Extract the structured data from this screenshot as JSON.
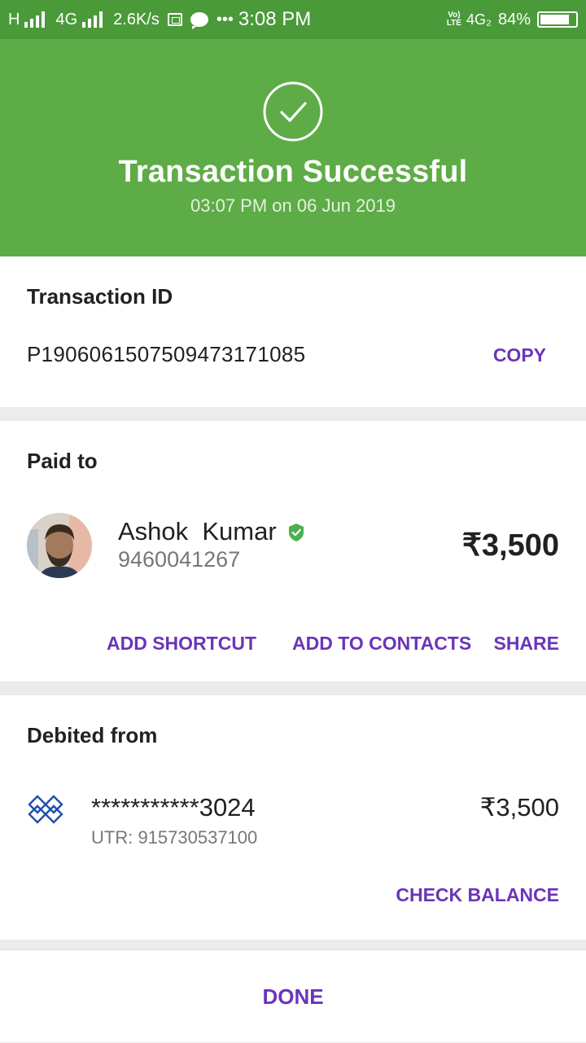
{
  "status_bar": {
    "network_h": "H",
    "network_4g": "4G",
    "speed": "2.6K/s",
    "dots": "•••",
    "time": "3:08 PM",
    "volte_top": "Vo)",
    "volte_bottom": "LTE",
    "network_4g2": "4G₂",
    "battery": "84%",
    "battery_level": 0.84
  },
  "header": {
    "icon": "check-circle-icon",
    "title": "Transaction Successful",
    "subtitle": "03:07 PM on 06 Jun 2019",
    "bg_color": "#5eac47"
  },
  "transaction": {
    "title": "Transaction ID",
    "id": "P1906061507509473171085",
    "copy_label": "COPY"
  },
  "paid_to": {
    "title": "Paid to",
    "name": "Ashok  Kumar",
    "verified_icon": "verified-shield-icon",
    "phone": "9460041267",
    "amount": "₹3,500",
    "actions": {
      "add_shortcut": "ADD SHORTCUT",
      "add_contacts": "ADD TO CONTACTS",
      "share": "SHARE"
    }
  },
  "debited_from": {
    "title": "Debited from",
    "bank_icon": "bank-logo-icon",
    "account": "***********3024",
    "utr": "UTR: 915730537100",
    "amount": "₹3,500",
    "check_balance_label": "CHECK BALANCE"
  },
  "footer": {
    "done_label": "DONE"
  },
  "colors": {
    "accent": "#6a35b8",
    "success": "#5eac47",
    "verified": "#4caf50"
  }
}
